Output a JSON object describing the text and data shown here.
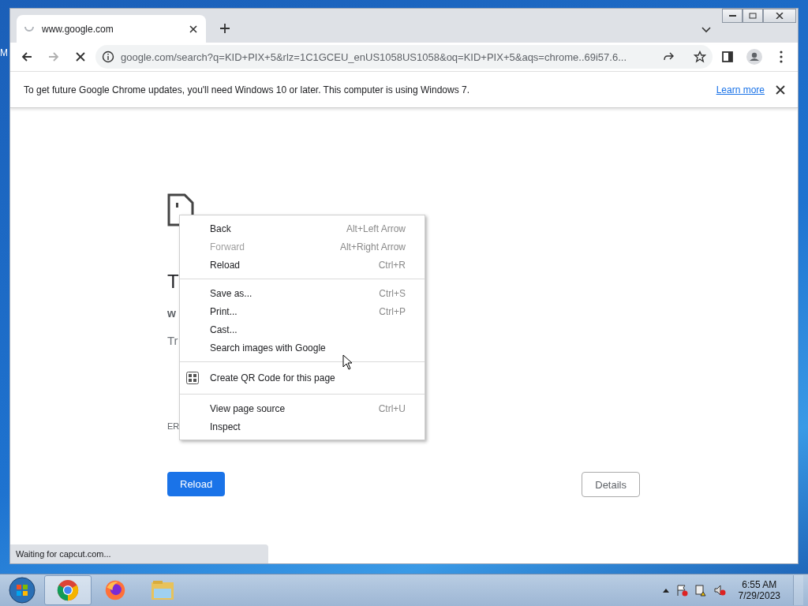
{
  "desktop": {
    "icon_label": "M"
  },
  "window": {
    "tab": {
      "title": "www.google.com",
      "loading": true
    },
    "address": "google.com/search?q=KID+PIX+5&rlz=1C1GCEU_enUS1058US1058&oq=KID+PIX+5&aqs=chrome..69i57.6...",
    "infobar": {
      "message": "To get future Google Chrome updates, you'll need Windows 10 or later. This computer is using Windows 7.",
      "link": "Learn more"
    },
    "page": {
      "heading": "T",
      "domain": "w",
      "hint": "Tr",
      "error_code": "ER",
      "buttons": [
        {
          "label": "Reload",
          "kind": "primary"
        },
        {
          "label": "Details",
          "kind": "secondary"
        }
      ]
    },
    "status": "Waiting for capcut.com..."
  },
  "context_menu": {
    "groups": [
      [
        {
          "label": "Back",
          "shortcut": "Alt+Left Arrow",
          "disabled": false,
          "kind": "plain"
        },
        {
          "label": "Forward",
          "shortcut": "Alt+Right Arrow",
          "disabled": true,
          "kind": "plain"
        },
        {
          "label": "Reload",
          "shortcut": "Ctrl+R",
          "disabled": false,
          "kind": "plain"
        }
      ],
      [
        {
          "label": "Save as...",
          "shortcut": "Ctrl+S",
          "disabled": false,
          "kind": "plain"
        },
        {
          "label": "Print...",
          "shortcut": "Ctrl+P",
          "disabled": false,
          "kind": "plain"
        },
        {
          "label": "Cast...",
          "disabled": false,
          "kind": "plain"
        },
        {
          "label": "Search images with Google",
          "disabled": false,
          "kind": "plain"
        }
      ],
      [
        {
          "label": "Create QR Code for this page",
          "disabled": false,
          "kind": "qr"
        }
      ],
      [
        {
          "label": "View page source",
          "shortcut": "Ctrl+U",
          "disabled": false,
          "kind": "plain"
        },
        {
          "label": "Inspect",
          "disabled": false,
          "kind": "plain"
        }
      ]
    ]
  },
  "taskbar": {
    "apps": [
      {
        "kind": "chrome",
        "selected": true
      },
      {
        "kind": "firefox",
        "selected": false
      },
      {
        "kind": "explorer",
        "selected": false
      }
    ],
    "time": "6:55 AM",
    "date": "7/29/2023"
  }
}
